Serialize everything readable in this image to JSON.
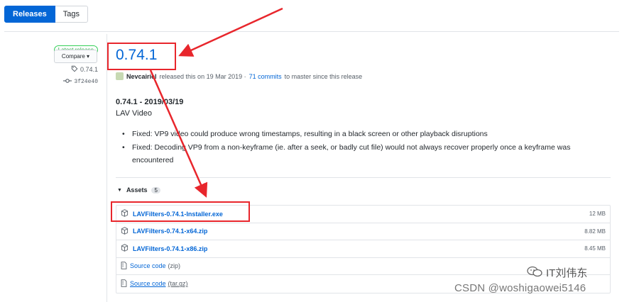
{
  "tabs": {
    "releases": "Releases",
    "tags": "Tags"
  },
  "sidebar": {
    "latest_badge": "Latest release",
    "tag": "0.74.1",
    "commit": "3f24e40",
    "compare": "Compare ▾"
  },
  "release": {
    "version": "0.74.1",
    "author": "Nevcairiel",
    "released_text": "released this on 19 Mar 2019 ·",
    "commits_link": "71 commits",
    "commits_suffix": "to master since this release",
    "heading": "0.74.1 - 2019/03/19",
    "subtitle": "LAV Video",
    "bullets": [
      "Fixed: VP9 video could produce wrong timestamps, resulting in a black screen or other playback disruptions",
      "Fixed: Decoding VP9 from a non-keyframe (ie. after a seek, or badly cut file) would not always recover properly once a keyframe was encountered"
    ]
  },
  "assets": {
    "label": "Assets",
    "count": "5",
    "files": [
      {
        "name": "LAVFilters-0.74.1-Installer.exe",
        "size": "12 MB"
      },
      {
        "name": "LAVFilters-0.74.1-x64.zip",
        "size": "8.82 MB"
      },
      {
        "name": "LAVFilters-0.74.1-x86.zip",
        "size": "8.45 MB"
      }
    ],
    "sources": [
      {
        "label": "Source code",
        "ext": "(zip)"
      },
      {
        "label": "Source code",
        "ext": "(tar.gz)"
      }
    ]
  },
  "watermark": {
    "brand": "IT刘伟东",
    "csdn": "CSDN @woshigaowei5146"
  },
  "colors": {
    "link": "#0366d6",
    "accent_green": "#28a745",
    "annotation_red": "#e8262c"
  }
}
